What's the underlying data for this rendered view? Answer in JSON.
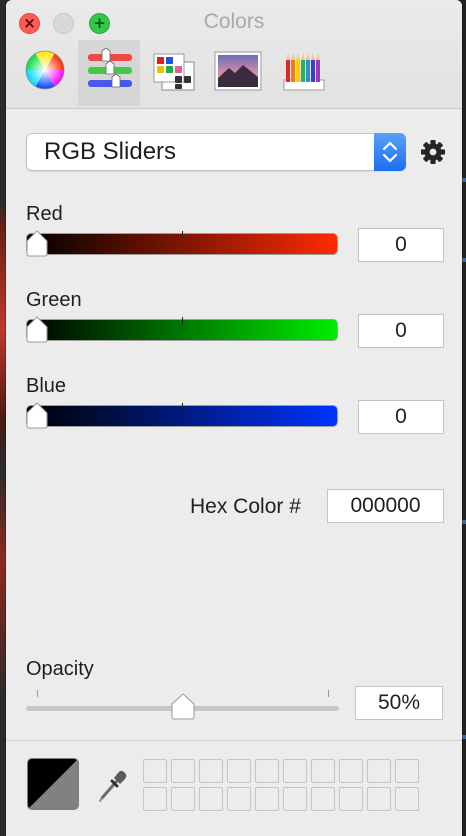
{
  "window": {
    "title": "Colors"
  },
  "toolbar": {
    "tabs": [
      {
        "name": "color-wheel",
        "icon": "color-wheel-icon",
        "selected": false
      },
      {
        "name": "color-sliders",
        "icon": "sliders-icon",
        "selected": true
      },
      {
        "name": "color-palettes",
        "icon": "palette-icon",
        "selected": false
      },
      {
        "name": "image-palettes",
        "icon": "image-icon",
        "selected": false
      },
      {
        "name": "pencils",
        "icon": "pencils-icon",
        "selected": false
      }
    ]
  },
  "mode_popup": {
    "selected": "RGB Sliders"
  },
  "sliders": [
    {
      "label": "Red",
      "value": "0",
      "color": "#ff2a00"
    },
    {
      "label": "Green",
      "value": "0",
      "color": "#00ee00"
    },
    {
      "label": "Blue",
      "value": "0",
      "color": "#0033ff"
    }
  ],
  "hex": {
    "label": "Hex Color #",
    "value": "000000"
  },
  "opacity": {
    "label": "Opacity",
    "value": "50%",
    "fraction": 0.5
  },
  "current_color": {
    "hex": "#000000"
  },
  "swatches": {
    "count": 20
  },
  "colors": {
    "accent": "#1c6ff0",
    "window_bg": "#ececec"
  }
}
